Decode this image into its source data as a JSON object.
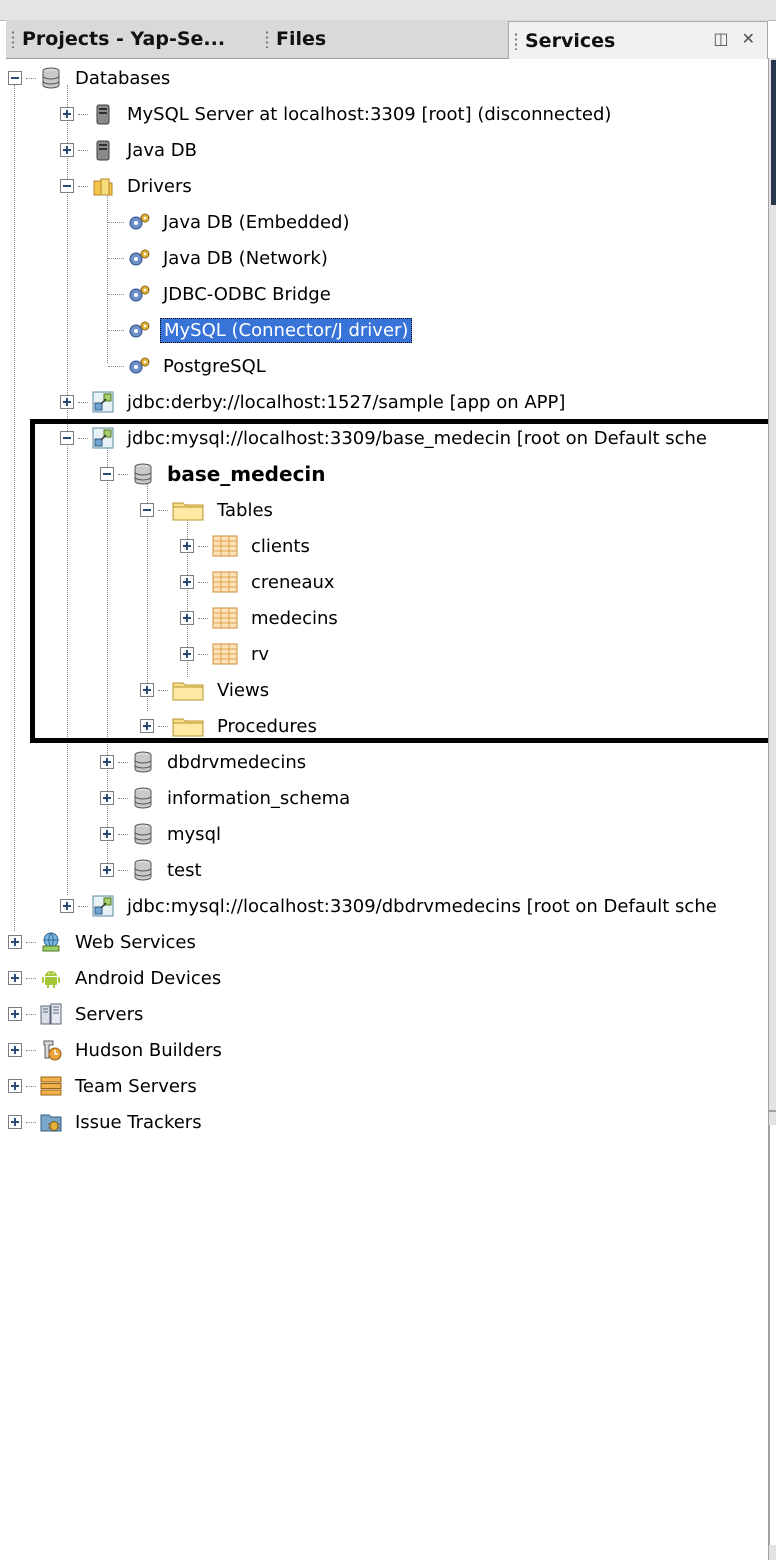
{
  "tabs": [
    {
      "label": "Projects - Yap-Se..."
    },
    {
      "label": "Files"
    },
    {
      "label": "Services",
      "controls": "◫ ✕"
    }
  ],
  "tree": [
    {
      "label": "Databases",
      "icon": "database-icon"
    },
    {
      "label": "MySQL Server at localhost:3309 [root] (disconnected)",
      "icon": "server-icon"
    },
    {
      "label": "Java DB",
      "icon": "server-icon"
    },
    {
      "label": "Drivers",
      "icon": "folder-icon"
    },
    {
      "label": "Java DB (Embedded)",
      "icon": "driver-icon"
    },
    {
      "label": "Java DB (Network)",
      "icon": "driver-icon"
    },
    {
      "label": "JDBC-ODBC Bridge",
      "icon": "driver-icon"
    },
    {
      "label": "MySQL (Connector/J driver)",
      "icon": "driver-icon"
    },
    {
      "label": "PostgreSQL",
      "icon": "driver-icon"
    },
    {
      "label": "jdbc:derby://localhost:1527/sample [app on APP]",
      "icon": "connection-icon"
    },
    {
      "label": "jdbc:mysql://localhost:3309/base_medecin [root on Default sche",
      "icon": "connection-icon"
    },
    {
      "label": "base_medecin",
      "icon": "database-icon"
    },
    {
      "label": "Tables",
      "icon": "folder-icon"
    },
    {
      "label": "clients",
      "icon": "table-icon"
    },
    {
      "label": "creneaux",
      "icon": "table-icon"
    },
    {
      "label": "medecins",
      "icon": "table-icon"
    },
    {
      "label": "rv",
      "icon": "table-icon"
    },
    {
      "label": "Views",
      "icon": "folder-icon"
    },
    {
      "label": "Procedures",
      "icon": "folder-icon"
    },
    {
      "label": "dbdrvmedecins",
      "icon": "database-icon"
    },
    {
      "label": "information_schema",
      "icon": "database-icon"
    },
    {
      "label": "mysql",
      "icon": "database-icon"
    },
    {
      "label": "test",
      "icon": "database-icon"
    },
    {
      "label": "jdbc:mysql://localhost:3309/dbdrvmedecins [root on Default sche",
      "icon": "connection-icon"
    },
    {
      "label": "Web Services",
      "icon": "web-services-icon"
    },
    {
      "label": "Android Devices",
      "icon": "android-icon"
    },
    {
      "label": "Servers",
      "icon": "servers-icon"
    },
    {
      "label": "Hudson Builders",
      "icon": "hudson-icon"
    },
    {
      "label": "Team Servers",
      "icon": "team-servers-icon"
    },
    {
      "label": "Issue Trackers",
      "icon": "issue-tracker-icon"
    }
  ]
}
